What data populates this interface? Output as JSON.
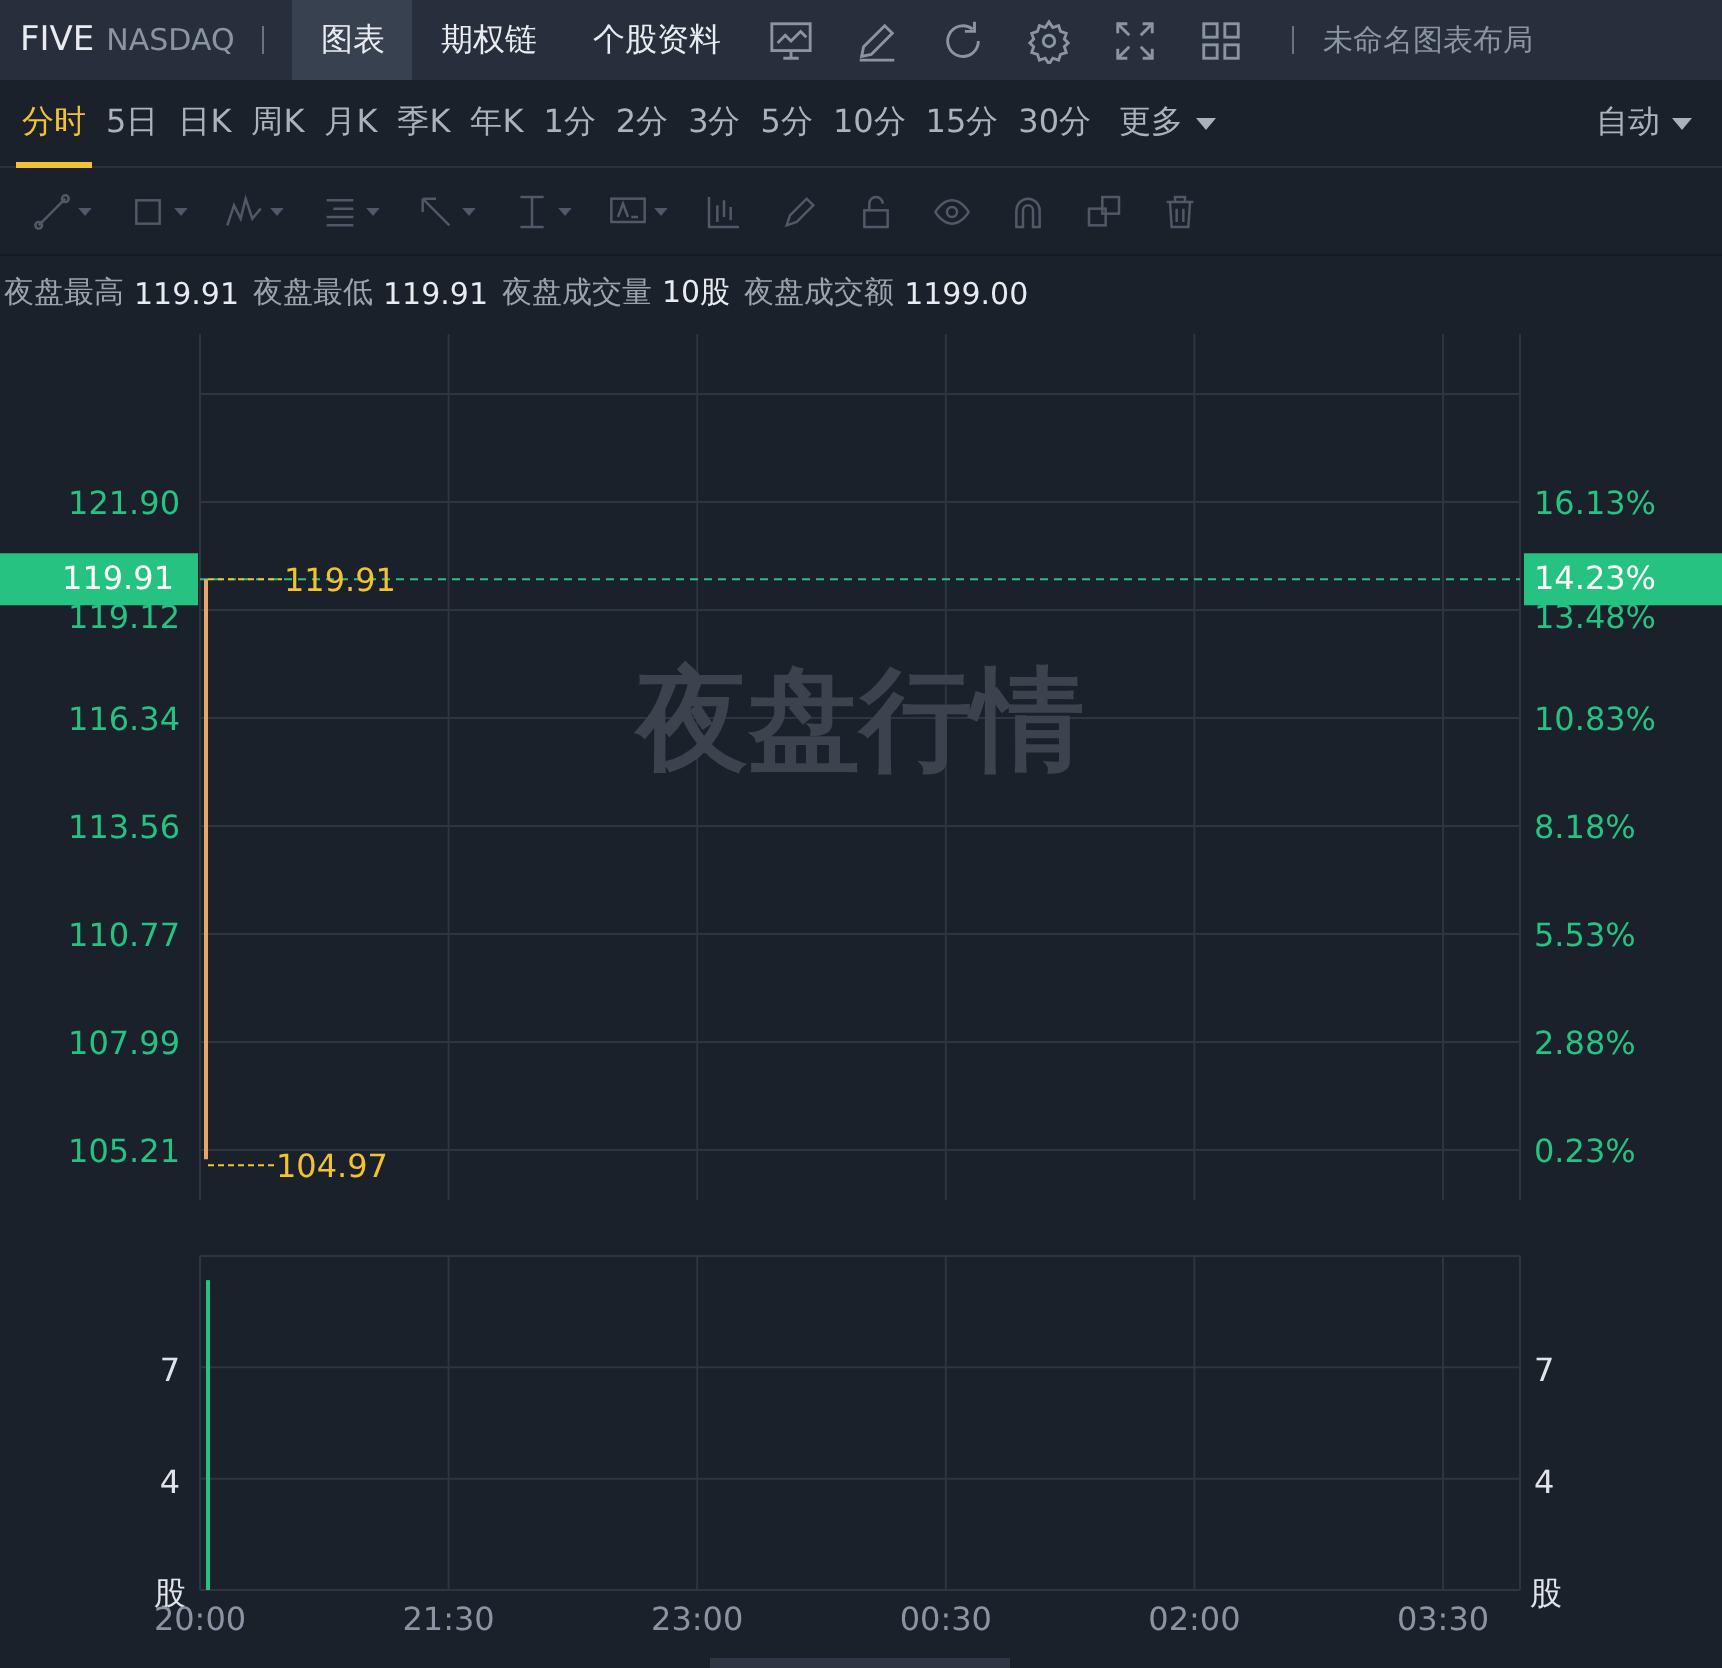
{
  "header": {
    "symbol": "FIVE",
    "exchange": "NASDAQ",
    "layout_name": "未命名图表布局",
    "tabs": [
      {
        "label": "图表",
        "selected": true
      },
      {
        "label": "期权链",
        "selected": false
      },
      {
        "label": "个股资料",
        "selected": false
      }
    ]
  },
  "periods": [
    {
      "label": "分时",
      "selected": true
    },
    {
      "label": "5日",
      "selected": false
    },
    {
      "label": "日K",
      "selected": false
    },
    {
      "label": "周K",
      "selected": false
    },
    {
      "label": "月K",
      "selected": false
    },
    {
      "label": "季K",
      "selected": false
    },
    {
      "label": "年K",
      "selected": false
    },
    {
      "label": "1分",
      "selected": false
    },
    {
      "label": "2分",
      "selected": false
    },
    {
      "label": "3分",
      "selected": false
    },
    {
      "label": "5分",
      "selected": false
    },
    {
      "label": "10分",
      "selected": false
    },
    {
      "label": "15分",
      "selected": false
    },
    {
      "label": "30分",
      "selected": false
    }
  ],
  "more": "更多",
  "mode": "自动",
  "tools": [
    {
      "kind": "line",
      "caret": true,
      "disabled": true
    },
    {
      "kind": "rect",
      "caret": true,
      "disabled": true
    },
    {
      "kind": "pattern",
      "caret": true,
      "disabled": true
    },
    {
      "kind": "lines",
      "caret": true,
      "disabled": true
    },
    {
      "kind": "arrow",
      "caret": true,
      "disabled": true
    },
    {
      "kind": "measure",
      "caret": true,
      "disabled": true
    },
    {
      "kind": "text",
      "caret": true,
      "disabled": true
    },
    {
      "kind": "candle",
      "caret": false,
      "disabled": true
    },
    {
      "kind": "pencil",
      "caret": false,
      "disabled": true
    },
    {
      "kind": "lock",
      "caret": false,
      "disabled": true
    },
    {
      "kind": "eye",
      "caret": false,
      "disabled": true
    },
    {
      "kind": "magnet",
      "caret": false,
      "disabled": true
    },
    {
      "kind": "copy",
      "caret": false,
      "disabled": true
    },
    {
      "kind": "trash",
      "caret": false,
      "disabled": true
    }
  ],
  "stats": [
    {
      "label": "夜盘最高",
      "value": "119.91"
    },
    {
      "label": "夜盘最低",
      "value": "119.91"
    },
    {
      "label": "夜盘成交量",
      "value": "10股"
    },
    {
      "label": "夜盘成交额",
      "value": "1199.00"
    }
  ],
  "price_chart": {
    "watermark": "夜盘行情",
    "current_price": "119.91",
    "current_change": "14.23%",
    "high_label": "119.91",
    "low_label": "104.97",
    "left_ticks": [
      "121.90",
      "119.12",
      "116.34",
      "113.56",
      "110.77",
      "107.99",
      "105.21"
    ],
    "right_ticks": [
      "16.13%",
      "13.48%",
      "10.83%",
      "8.18%",
      "5.53%",
      "2.88%",
      "0.23%"
    ]
  },
  "volume_chart": {
    "unit_left": "股",
    "unit_right": "股",
    "right_ticks": [
      "7",
      "4"
    ],
    "chart_data": {
      "type": "bar",
      "categories": [
        "20:00",
        "21:30",
        "23:00",
        "00:30",
        "02:00",
        "03:30"
      ],
      "values": [
        9.35,
        null,
        null,
        null,
        null,
        null
      ],
      "ylim": [
        1,
        10
      ],
      "yticks": [
        4,
        7
      ],
      "grid": true
    }
  }
}
